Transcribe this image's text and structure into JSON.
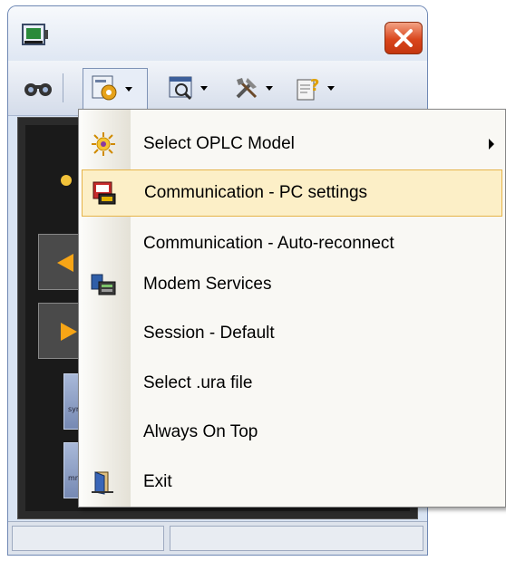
{
  "window": {
    "icon": "plc-app-icon",
    "close_icon": "close-icon"
  },
  "toolbar": {
    "items": [
      {
        "name": "binoculars-icon"
      },
      {
        "name": "settings-icon"
      },
      {
        "name": "view-icon"
      },
      {
        "name": "tools-icon"
      },
      {
        "name": "help-icon"
      }
    ]
  },
  "menu": {
    "items": [
      {
        "label": "Select OPLC Model",
        "icon": "sun-icon",
        "submenu": true,
        "highlighted": false
      },
      {
        "label": "Communication - PC settings",
        "icon": "communication-settings-icon",
        "submenu": false,
        "highlighted": true
      },
      {
        "label": "Communication - Auto-reconnect",
        "icon": "",
        "submenu": false,
        "highlighted": false
      },
      {
        "label": "Modem Services",
        "icon": "modem-icon",
        "submenu": false,
        "highlighted": false
      },
      {
        "label": "Session - Default",
        "icon": "",
        "submenu": false,
        "highlighted": false
      },
      {
        "label": "Select .ura file",
        "icon": "",
        "submenu": false,
        "highlighted": false
      },
      {
        "label": "Always On Top",
        "icon": "",
        "submenu": false,
        "highlighted": false
      },
      {
        "label": "Exit",
        "icon": "exit-door-icon",
        "submenu": false,
        "highlighted": false
      }
    ]
  },
  "panel": {
    "tile1_text": "symb",
    "tile2_text": "mno"
  },
  "colors": {
    "highlight_bg": "#fcefc7",
    "highlight_border": "#e6b44a",
    "close_button": "#d9451c",
    "panel_bg": "#1a1a1a",
    "arrow_orange": "#f7a516"
  }
}
